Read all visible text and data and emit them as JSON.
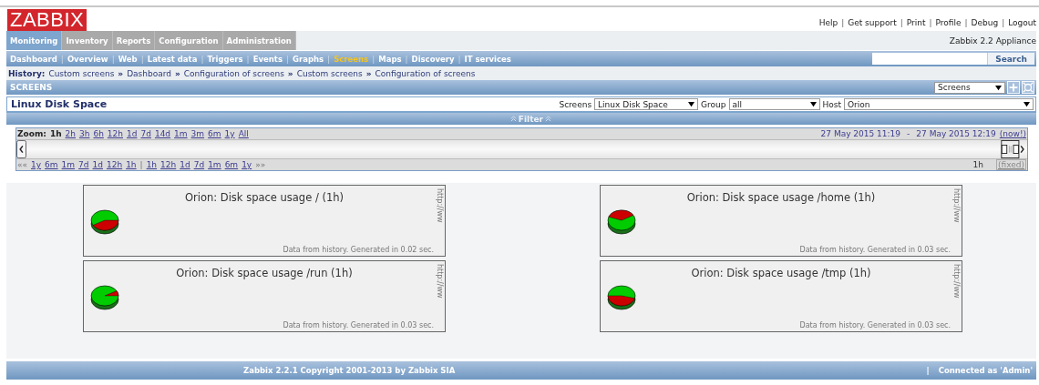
{
  "logo": "ZABBIX",
  "top_links": {
    "separator": "|",
    "items": [
      "Help",
      "Get support",
      "Print",
      "Profile",
      "Debug",
      "Logout"
    ]
  },
  "sub_menu_separator": "|",
  "main_menu": [
    {
      "label": "Monitoring",
      "selected": true
    },
    {
      "label": "Inventory",
      "selected": false
    },
    {
      "label": "Reports",
      "selected": false
    },
    {
      "label": "Configuration",
      "selected": false
    },
    {
      "label": "Administration",
      "selected": false
    }
  ],
  "appliance": "Zabbix 2.2 Appliance",
  "sub_menu": [
    {
      "label": "Dashboard",
      "selected": false
    },
    {
      "label": "Overview",
      "selected": false
    },
    {
      "label": "Web",
      "selected": false
    },
    {
      "label": "Latest data",
      "selected": false
    },
    {
      "label": "Triggers",
      "selected": false
    },
    {
      "label": "Events",
      "selected": false
    },
    {
      "label": "Graphs",
      "selected": false
    },
    {
      "label": "Screens",
      "selected": true
    },
    {
      "label": "Maps",
      "selected": false
    },
    {
      "label": "Discovery",
      "selected": false
    },
    {
      "label": "IT services",
      "selected": false
    }
  ],
  "search": {
    "button": "Search"
  },
  "history": {
    "label": "History:",
    "separator": "»",
    "items": [
      "Custom screens",
      "Dashboard",
      "Configuration of screens",
      "Custom screens",
      "Configuration of screens"
    ]
  },
  "section_title": "SCREENS",
  "screens_dropdown": "Screens",
  "screen_title": "Linux Disk Space",
  "selectors": [
    {
      "label": "Screens",
      "value": "Linux Disk Space"
    },
    {
      "label": "Group",
      "value": "all"
    },
    {
      "label": "Host",
      "value": "Orion"
    }
  ],
  "filter": "Filter",
  "timeline": {
    "zoom_label": "Zoom:",
    "zoom": [
      {
        "label": "1h",
        "selected": true
      },
      {
        "label": "2h",
        "selected": false
      },
      {
        "label": "3h",
        "selected": false
      },
      {
        "label": "6h",
        "selected": false
      },
      {
        "label": "12h",
        "selected": false
      },
      {
        "label": "1d",
        "selected": false
      },
      {
        "label": "7d",
        "selected": false
      },
      {
        "label": "14d",
        "selected": false
      },
      {
        "label": "1m",
        "selected": false
      },
      {
        "label": "3m",
        "selected": false
      },
      {
        "label": "6m",
        "selected": false
      },
      {
        "label": "1y",
        "selected": false
      },
      {
        "label": "All",
        "selected": false
      }
    ],
    "period_from": "27 May 2015 11:19",
    "dash": "-",
    "period_to": "27 May 2015 12:19",
    "now": "(now!)",
    "back_mark": "««",
    "back": [
      "1y",
      "6m",
      "1m",
      "7d",
      "1d",
      "12h",
      "1h"
    ],
    "divider": "|",
    "forward": [
      "1h",
      "12h",
      "1d",
      "7d",
      "1m",
      "6m",
      "1y"
    ],
    "forward_mark": "»»",
    "period": "1h",
    "fixed": "(fixed)"
  },
  "graphs": [
    {
      "title": "Orion: Disk space usage / (1h)",
      "url_mark": "http://ww",
      "footer": "Data from history. Generated in 0.02 sec."
    },
    {
      "title": "Orion: Disk space usage /home (1h)",
      "url_mark": "http://ww",
      "footer": "Data from history. Generated in 0.03 sec."
    },
    {
      "title": "Orion: Disk space usage /run (1h)",
      "url_mark": "http://ww",
      "footer": "Data from history. Generated in 0.03 sec."
    },
    {
      "title": "Orion: Disk space usage /tmp (1h)",
      "url_mark": "http://ww",
      "footer": "Data from history. Generated in 0.03 sec."
    }
  ],
  "footer": {
    "copyright": "Zabbix 2.2.1 Copyright 2001-2013 by Zabbix SIA",
    "divider": "|",
    "connected": "Connected as 'Admin'"
  }
}
